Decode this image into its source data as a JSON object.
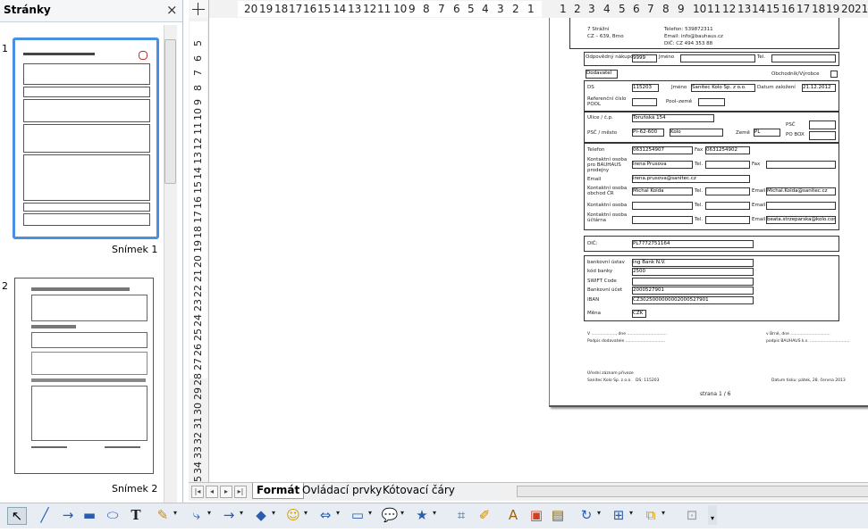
{
  "panel": {
    "title": "Stránky",
    "close": "×"
  },
  "slides": [
    {
      "number": "1",
      "caption": "Snímek 1"
    },
    {
      "number": "2",
      "caption": "Snímek 2"
    }
  ],
  "hruler": [
    "20",
    "19",
    "18",
    "17",
    "16",
    "15",
    "14",
    "13",
    "12",
    "11",
    "10",
    "9",
    "8",
    "7",
    "6",
    "5",
    "4",
    "3",
    "2",
    "1",
    "1",
    "2",
    "3",
    "4",
    "5",
    "6",
    "7",
    "8",
    "9",
    "10",
    "11",
    "12",
    "13",
    "14",
    "15",
    "16",
    "17",
    "18",
    "19",
    "20",
    "21"
  ],
  "vruler": [
    "5",
    "6",
    "7",
    "8",
    "9",
    "10",
    "11",
    "12",
    "13",
    "14",
    "15",
    "16",
    "17",
    "18",
    "19",
    "20",
    "21",
    "22",
    "23",
    "24",
    "25",
    "26",
    "27",
    "28",
    "29",
    "30",
    "31",
    "32",
    "33",
    "34",
    "35"
  ],
  "tabs": [
    {
      "label": "Formát",
      "active": true
    },
    {
      "label": "Ovládací prvky",
      "active": false
    },
    {
      "label": "Kótovací čáry",
      "active": false
    }
  ],
  "doc": {
    "addr1": "7 Strážní",
    "addr2": "CZ – 639, Brno",
    "phone": "Telefon: 539872311",
    "email": "Email: info@bauhaus.cz",
    "dic": "DIČ: CZ 494 353 88",
    "buyer_label": "Odpovědný nákupčí",
    "buyer_value": "9999",
    "name_label": "Jméno",
    "tel_label": "Tel.",
    "supplier": "Dodavatel",
    "trader": "Obchodník/Výrobce",
    "ds_label": "DS",
    "ds_value": "115203",
    "jmeno_label": "Jméno",
    "company": "Sanitec Kolo Sp. z o.o.",
    "founded_label": "Datum založení",
    "founded_value": "21.12.2012",
    "ref_label": "Referenční číslo POOL",
    "pool_label": "Pool–země",
    "street_label": "Ulice / č.p.",
    "street_value": "Toruňská 154",
    "psc_label": "PSČ",
    "city_label": "PSČ / město",
    "zip_value": "Pl–62-600",
    "city_value": "Kolo",
    "country_label": "Země",
    "country_value": "PL",
    "pobox_label": "PO BOX",
    "phone_label": "Telefon",
    "phone_value": "0631254907",
    "fax_label": "Fax",
    "fax_value": "0631254902",
    "contact_label": "Kontaktní osoba pro BAUHAUS prodejny",
    "contact_value": "Irena Prusova",
    "email_label": "Email",
    "email_value": "irena.prusova@sanitec.cz",
    "contact2_label": "Kontaktní osoba obchod ČR",
    "contact2_value": "Michal Kolda",
    "contact2_email": "Michal.Kolda@sanitec.cz",
    "contact3_label": "Kontaktní osoba",
    "contact4_label": "Kontaktní osoba účtárna",
    "contact4_email": "beata.strzeparska@kolo.com.pl",
    "dic_label": "DIČ:",
    "dic_value": "PL7772751164",
    "bank_label": "bankovní ústav",
    "bank_value": "ing Bank N.V.",
    "bankcode_label": "kód banky",
    "bankcode_value": "2500",
    "swift_label": "SWIFT Code",
    "account_label": "Bankovní účet",
    "account_value": "2000527901",
    "iban_label": "IBAN",
    "iban_value": "CZ3025000000002000527901",
    "currency_label": "Měna",
    "currency_value": "CZK",
    "sign_left_place": "V ..................., dne ...............................",
    "sign_left": "Podpis dodavatele ...............................",
    "sign_right_place": "v Brně, dne ...............................",
    "sign_right": "podpis BAUHAUS k.s. ...............................",
    "footer1": "Úřední záznam přiveze",
    "footer2": "Sanitec Kolo Sp. z o.o.",
    "footer3": "DS: 115203",
    "footer4": "Datum tisku: pátek, 28. června 2013",
    "page_label": "strana 1 / 6"
  },
  "toolbar": [
    "select-arrow",
    "line",
    "arrow",
    "rectangle",
    "ellipse",
    "text",
    "curve",
    "connector",
    "lines-arrows",
    "basic-shapes",
    "symbol-shapes",
    "block-arrows",
    "flowchart",
    "callouts",
    "stars",
    "points",
    "glue",
    "fontwork",
    "from-file",
    "gallery",
    "rotate",
    "alignment",
    "arrange",
    "extrusion"
  ]
}
